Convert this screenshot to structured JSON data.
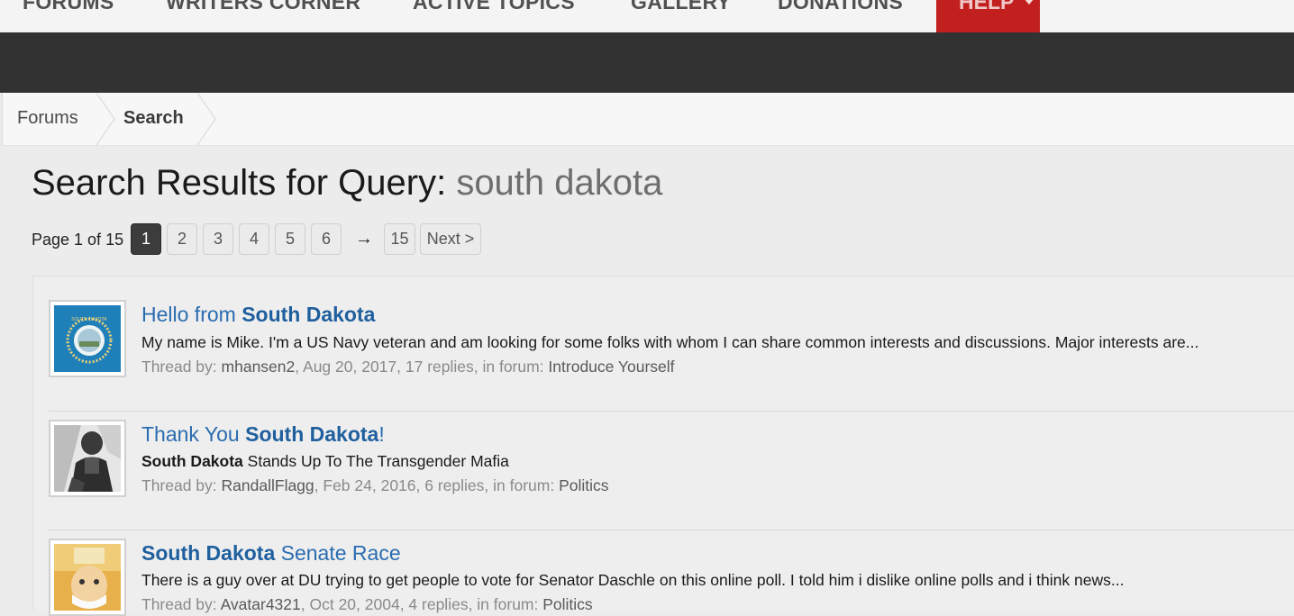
{
  "nav": {
    "items": [
      "FORUMS",
      "WRITERS CORNER",
      "ACTIVE TOPICS",
      "GALLERY",
      "DONATIONS"
    ],
    "help_label": "HELP",
    "help_color": "#c2201f"
  },
  "breadcrumb": {
    "items": [
      "Forums",
      "Search"
    ]
  },
  "heading": {
    "prefix": "Search Results for Query:",
    "query": "south dakota"
  },
  "pager": {
    "label": "Page 1 of 15",
    "pages": [
      "1",
      "2",
      "3",
      "4",
      "5",
      "6"
    ],
    "current": "1",
    "arrow": "→",
    "last": "15",
    "next": "Next >"
  },
  "results": [
    {
      "title_pre": "Hello from ",
      "title_bold": "South Dakota",
      "title_post": "",
      "snippet_bold": "",
      "snippet": "My name is Mike. I'm a US Navy veteran and am looking for some folks with whom I can share common interests and discussions. Major interests are...",
      "by_label": "Thread by: ",
      "author": "mhansen2",
      "details": ", Aug 20, 2017, 17 replies, in forum: ",
      "forum": "Introduce Yourself",
      "avatar_icon": "south-dakota-flag-icon"
    },
    {
      "title_pre": "Thank You ",
      "title_bold": "South Dakota",
      "title_post": "!",
      "snippet_bold": "South Dakota",
      "snippet": " Stands Up To The Transgender Mafia",
      "by_label": "Thread by: ",
      "author": "RandallFlagg",
      "details": ", Feb 24, 2016, 6 replies, in forum: ",
      "forum": "Politics",
      "avatar_icon": "man-portrait-icon"
    },
    {
      "title_pre": "",
      "title_bold": "South Dakota",
      "title_post": " Senate Race",
      "snippet_bold": "",
      "snippet": "There is a guy over at DU trying to get people to vote for Senator Daschle on this online poll. I told him i dislike online polls and i think news...",
      "by_label": "Thread by: ",
      "author": "Avatar4321",
      "details": ", Oct 20, 2004, 4 replies, in forum: ",
      "forum": "Politics",
      "avatar_icon": "cartoon-monopoly-man-icon"
    }
  ]
}
